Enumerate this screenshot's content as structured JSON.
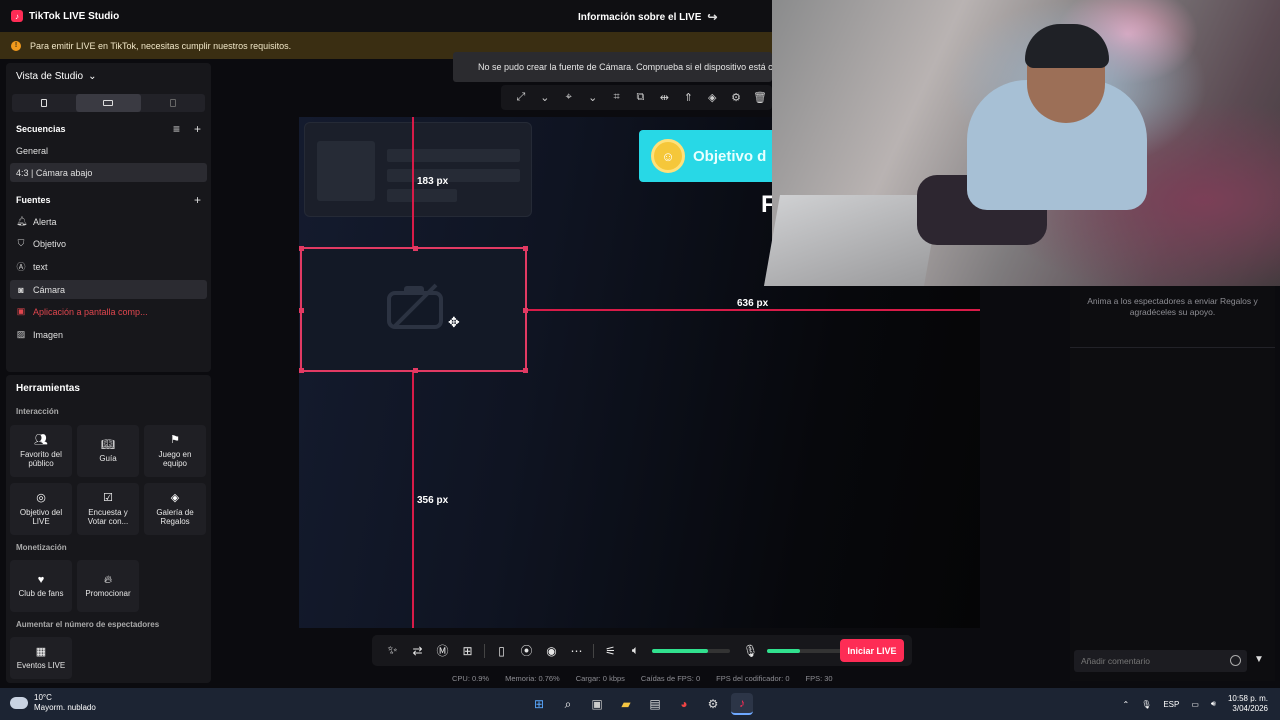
{
  "titlebar": {
    "app_title": "TikTok LIVE Studio",
    "live_info": "Información sobre el LIVE"
  },
  "banner": {
    "text": "Para emitir LIVE en TikTok, necesitas cumplir nuestros requisitos."
  },
  "notice": {
    "text": "No se pudo crear la fuente de Cámara. Comprueba si el dispositivo está co"
  },
  "sidebar": {
    "view_label": "Vista de Studio",
    "sequences_title": "Secuencias",
    "sequences": [
      "General",
      "4:3 | Cámara abajo"
    ],
    "sources_title": "Fuentes",
    "sources": [
      {
        "label": "Alerta",
        "icon": "bell-icon"
      },
      {
        "label": "Objetivo",
        "icon": "shield-icon"
      },
      {
        "label": "text",
        "icon": "text-icon"
      },
      {
        "label": "Cámara",
        "icon": "camera-icon"
      },
      {
        "label": "Aplicación a pantalla comp...",
        "icon": "app-icon"
      },
      {
        "label": "Imagen",
        "icon": "image-icon"
      }
    ]
  },
  "tools": {
    "title": "Herramientas",
    "categories": {
      "interaction": "Interacción",
      "monetization": "Monetización",
      "viewers": "Aumentar el número de espectadores"
    },
    "interaction_tiles": [
      {
        "label": "Favorito del público",
        "icon": "people-icon"
      },
      {
        "label": "Guía",
        "icon": "book-icon"
      },
      {
        "label": "Juego en equipo",
        "icon": "team-icon"
      },
      {
        "label": "Objetivo del LIVE",
        "icon": "target-icon"
      },
      {
        "label": "Encuesta y Votar con...",
        "icon": "poll-icon"
      },
      {
        "label": "Galería de Regalos",
        "icon": "gift-icon"
      }
    ],
    "monetization_tiles": [
      {
        "label": "Club de fans",
        "icon": "heart-icon"
      },
      {
        "label": "Promocionar",
        "icon": "flame-icon"
      }
    ],
    "viewer_tiles": [
      {
        "label": "Eventos LIVE",
        "icon": "calendar-icon"
      }
    ]
  },
  "canvas": {
    "goal_badge": "Objetivo d",
    "letter": "F",
    "measure_top": "183 px",
    "measure_right": "636 px",
    "measure_bottom": "356 px"
  },
  "chat": {
    "gift_hint": "Anima a los espectadores a enviar Regalos y agradéceles su apoyo.",
    "comment_placeholder": "Añadir comentario"
  },
  "controls": {
    "go_live": "Iniciar LIVE",
    "speaker_level": 0.72,
    "mic_level": 0.42,
    "accent_color": "#fe2c55",
    "meter_color": "#31e08e"
  },
  "stats": [
    "CPU:  0.9%",
    "Memoria:  0.76%",
    "Cargar:  0 kbps",
    "Caídas de FPS:  0",
    "FPS del codificador:  0",
    "FPS:  30"
  ],
  "taskbar": {
    "temperature": "10°C",
    "weather": "Mayorm. nublado",
    "language": "ESP",
    "time": "10:58 p. m.",
    "date": "3/04/2026"
  }
}
